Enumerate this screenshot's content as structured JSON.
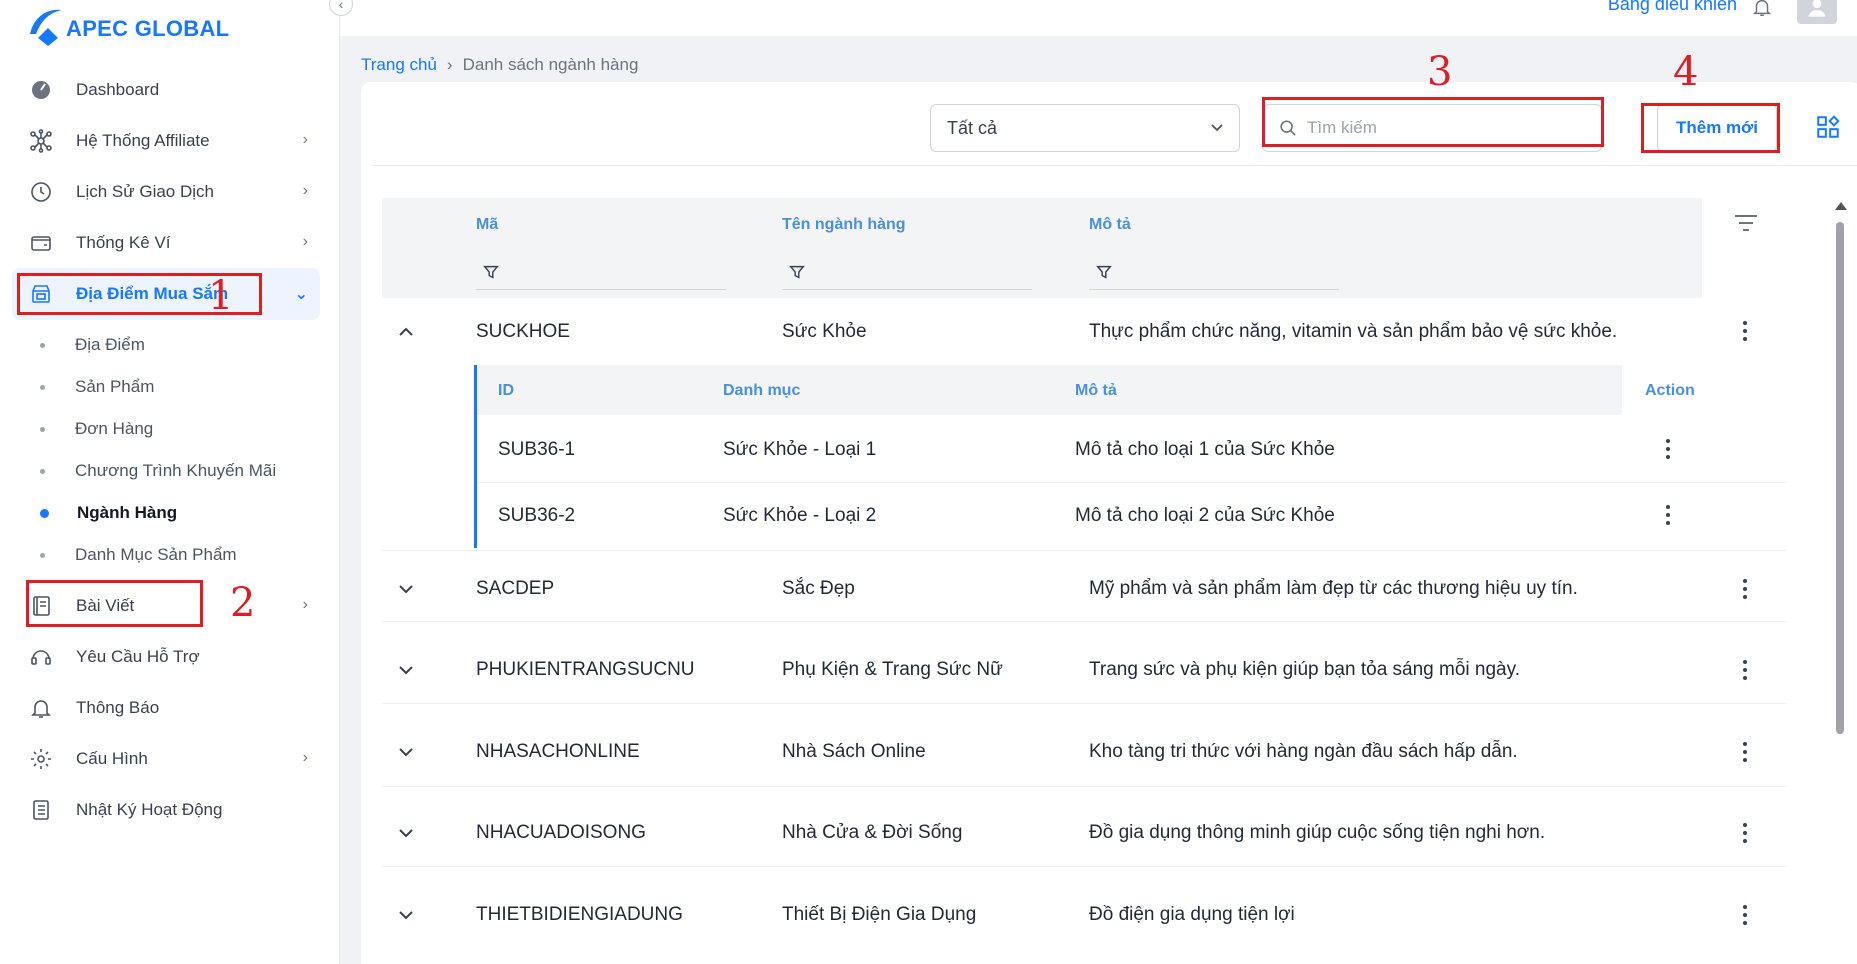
{
  "app": {
    "brand": "APEC GLOBAL",
    "brand_color": "#1677ff"
  },
  "topbar": {
    "link_label": "Bảng điều khiển"
  },
  "sidebar": {
    "items": [
      {
        "label": "Dashboard",
        "icon": "dashboard-icon"
      },
      {
        "label": "Hệ Thống Affiliate",
        "icon": "network-icon"
      },
      {
        "label": "Lịch Sử Giao Dịch",
        "icon": "clock-icon"
      },
      {
        "label": "Thống Kê Ví",
        "icon": "wallet-icon"
      },
      {
        "label": "Địa Điểm Mua Sắm",
        "icon": "store-icon"
      },
      {
        "label": "Bài Viết",
        "icon": "document-icon"
      },
      {
        "label": "Yêu Cầu Hỗ Trợ",
        "icon": "headset-icon"
      },
      {
        "label": "Thông Báo",
        "icon": "bell-icon"
      },
      {
        "label": "Cấu Hình",
        "icon": "gear-icon"
      },
      {
        "label": "Nhật Ký Hoạt Động",
        "icon": "log-icon"
      }
    ],
    "subitems": [
      "Địa Điểm",
      "Sản Phẩm",
      "Đơn Hàng",
      "Chương Trình Khuyến Mãi",
      "Ngành Hàng",
      "Danh Mục Sản Phẩm"
    ]
  },
  "annotations": [
    "1",
    "2",
    "3",
    "4"
  ],
  "breadcrumb": {
    "home": "Trang chủ",
    "current": "Danh sách ngành hàng"
  },
  "toolbar": {
    "select_value": "Tất cả",
    "search_placeholder": "Tìm kiếm",
    "add_label": "Thêm mới"
  },
  "table": {
    "headers": {
      "code": "Mã",
      "name": "Tên ngành hàng",
      "desc": "Mô tả"
    },
    "rows": [
      {
        "code": "SUCKHOE",
        "name": "Sức Khỏe",
        "desc": "Thực phẩm chức năng, vitamin và sản phẩm bảo vệ sức khỏe."
      },
      {
        "code": "SACDEP",
        "name": "Sắc Đẹp",
        "desc": "Mỹ phẩm và sản phẩm làm đẹp từ các thương hiệu uy tín."
      },
      {
        "code": "PHUKIENTRANGSUCNU",
        "name": "Phụ Kiện & Trang Sức Nữ",
        "desc": "Trang sức và phụ kiện giúp bạn tỏa sáng mỗi ngày."
      },
      {
        "code": "NHASACHONLINE",
        "name": "Nhà Sách Online",
        "desc": "Kho tàng tri thức với hàng ngàn đầu sách hấp dẫn."
      },
      {
        "code": "NHACUADOISONG",
        "name": "Nhà Cửa & Đời Sống",
        "desc": "Đồ gia dụng thông minh giúp cuộc sống tiện nghi hơn."
      },
      {
        "code": "THIETBIDIENGIADUNG",
        "name": "Thiết Bị Điện Gia Dụng",
        "desc": "Đồ điện gia dụng tiện lợi"
      }
    ],
    "subtable": {
      "headers": {
        "id": "ID",
        "category": "Danh mục",
        "desc": "Mô tả",
        "action": "Action"
      },
      "rows": [
        {
          "id": "SUB36-1",
          "category": "Sức Khỏe - Loại 1",
          "desc": "Mô tả cho loại 1 của Sức Khỏe"
        },
        {
          "id": "SUB36-2",
          "category": "Sức Khỏe - Loại 2",
          "desc": "Mô tả cho loại 2 của Sức Khỏe"
        }
      ]
    }
  }
}
